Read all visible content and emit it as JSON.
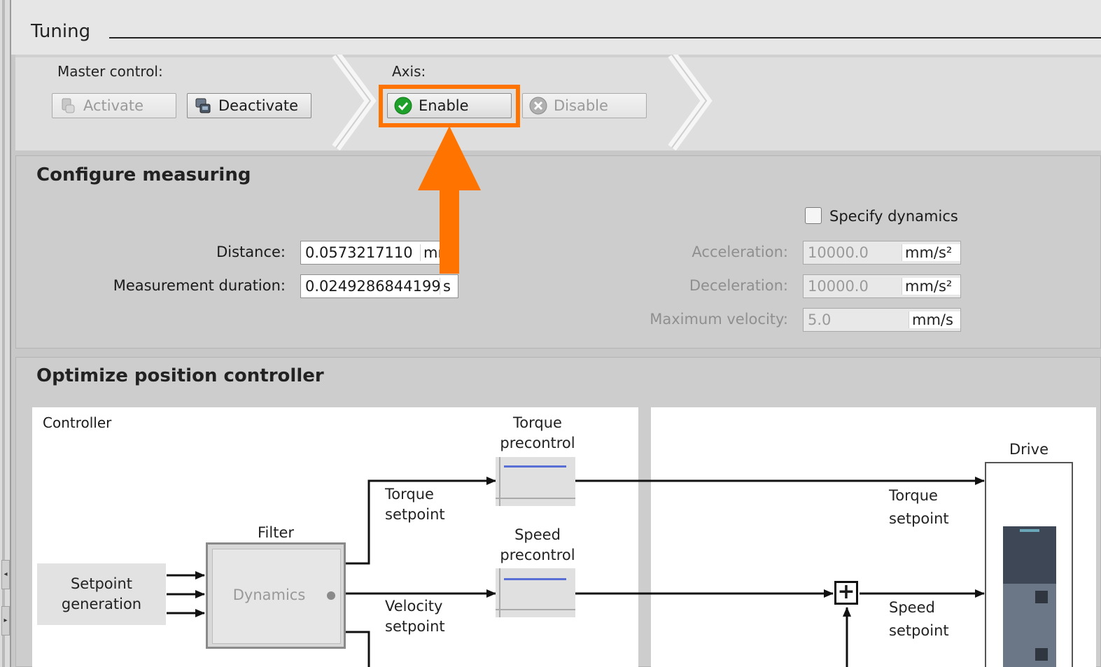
{
  "section": {
    "title": "Tuning"
  },
  "master_control": {
    "label": "Master control:",
    "activate": "Activate",
    "deactivate": "Deactivate"
  },
  "axis": {
    "label": "Axis:",
    "enable": "Enable",
    "disable": "Disable"
  },
  "configure_measuring": {
    "title": "Configure measuring",
    "distance_label": "Distance:",
    "distance_value": "0.0573217110",
    "distance_unit": "mm",
    "duration_label": "Measurement duration:",
    "duration_value": "0.02492868441995",
    "duration_unit": "s",
    "specify_dynamics_label": "Specify dynamics",
    "specify_dynamics_checked": false,
    "acceleration_label": "Acceleration:",
    "acceleration_value": "10000.0",
    "acceleration_unit": "mm/s²",
    "deceleration_label": "Deceleration:",
    "deceleration_value": "10000.0",
    "deceleration_unit": "mm/s²",
    "max_velocity_label": "Maximum velocity:",
    "max_velocity_value": "5.0",
    "max_velocity_unit": "mm/s"
  },
  "optimize": {
    "title": "Optimize position controller",
    "controller_label": "Controller",
    "setpoint_generation": "Setpoint generation",
    "filter_label": "Filter",
    "dynamics_label": "Dynamics",
    "torque_setpoint": "Torque setpoint",
    "velocity_setpoint": "Velocity setpoint",
    "torque_precontrol": "Torque precontrol",
    "speed_precontrol": "Speed precontrol",
    "drive_label": "Drive",
    "drive_torque_setpoint": "Torque setpoint",
    "drive_speed_setpoint": "Speed setpoint"
  },
  "colors": {
    "highlight": "#ff7300",
    "enable_icon": "#1fa02a",
    "precontrol_line": "#5a6fd6"
  }
}
